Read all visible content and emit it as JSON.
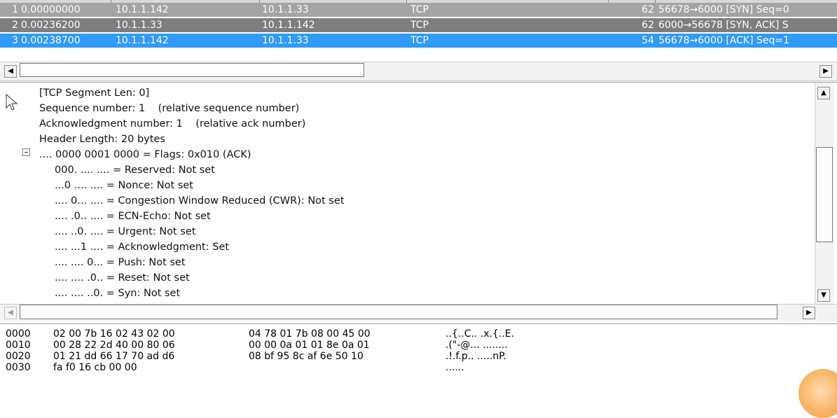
{
  "packet_list": {
    "rows": [
      {
        "no": "1",
        "time": "0.00000000",
        "src": "10.1.1.142",
        "dst": "10.1.1.33",
        "proto": "TCP",
        "len": "62",
        "info": "56678→6000 [SYN] Seq=0"
      },
      {
        "no": "2",
        "time": "0.00236200",
        "src": "10.1.1.33",
        "dst": "10.1.1.142",
        "proto": "TCP",
        "len": "62",
        "info": "6000→56678 [SYN, ACK] S"
      },
      {
        "no": "3",
        "time": "0.00238700",
        "src": "10.1.1.142",
        "dst": "10.1.1.33",
        "proto": "TCP",
        "len": "54",
        "info": "56678→6000 [ACK] Seq=1"
      }
    ],
    "selected_row": "3"
  },
  "scroll": {
    "left_arrow": "◀",
    "right_arrow": "▶",
    "up_arrow": "▲",
    "down_arrow": "▼"
  },
  "detail": {
    "lines": [
      "[TCP Segment Len: 0]",
      "Sequence number: 1    (relative sequence number)",
      "Acknowledgment number: 1    (relative ack number)",
      "Header Length: 20 bytes",
      ".... 0000 0001 0000 = Flags: 0x010 (ACK)",
      "000. .... .... = Reserved: Not set",
      "...0 .... .... = Nonce: Not set",
      ".... 0... .... = Congestion Window Reduced (CWR): Not set",
      ".... .0.. .... = ECN-Echo: Not set",
      ".... ..0. .... = Urgent: Not set",
      ".... ...1 .... = Acknowledgment: Set",
      ".... .... 0... = Push: Not set",
      ".... .... .0.. = Reset: Not set",
      ".... .... ..0. = Syn: Not set"
    ]
  },
  "hex": {
    "rows": [
      {
        "offset": "0000",
        "b1": "02 00 7b 16 02 43 02 00",
        "b2": "04 78 01 7b 08 00 45 00",
        "ascii": "..{..C.. .x.{..E."
      },
      {
        "offset": "0010",
        "b1": "00 28 22 2d 40 00 80 06",
        "b2": "00 00 0a 01 01 8e 0a 01",
        "ascii": ".(\"-@... ........"
      },
      {
        "offset": "0020",
        "b1": "01 21 dd 66 17 70 ad d6",
        "b2": "08 bf 95 8c af 6e 50 10",
        "ascii": ".!.f.p.. .....nP."
      },
      {
        "offset": "0030",
        "b1": "fa f0 16 cb 00 00",
        "b2": "",
        "ascii": "......"
      }
    ]
  },
  "colors": {
    "selected_row": "#2f9aff",
    "row1": "#a4a4a4",
    "row2": "#7e7e7e"
  }
}
